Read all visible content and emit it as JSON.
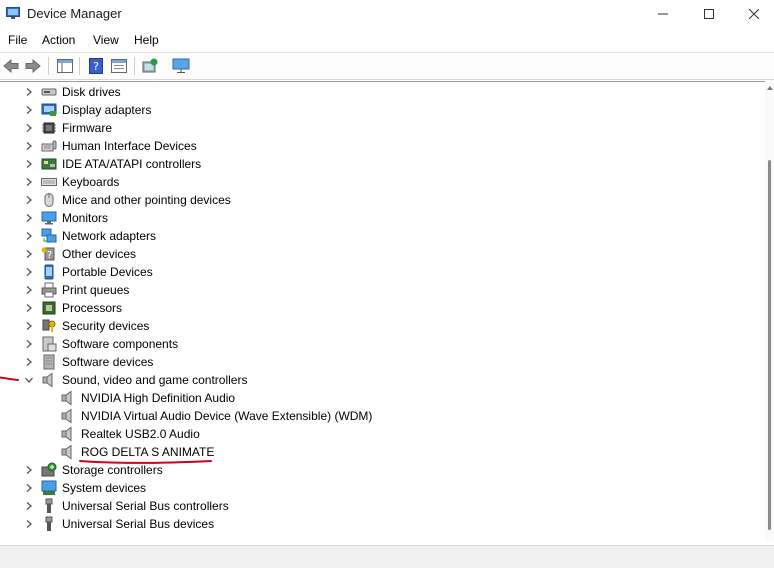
{
  "window": {
    "title": "Device Manager",
    "icon": "device-manager-icon"
  },
  "menu": [
    "File",
    "Action",
    "View",
    "Help"
  ],
  "toolbar": [
    "back-icon",
    "forward-icon",
    "properties-pane-icon",
    "help-icon",
    "show-hidden-icon",
    "scan-hardware-icon",
    "monitor-icon"
  ],
  "tree": {
    "categories": [
      {
        "label": "Disk drives",
        "icon": "disk-icon",
        "expanded": false
      },
      {
        "label": "Display adapters",
        "icon": "display-adapter-icon",
        "expanded": false
      },
      {
        "label": "Firmware",
        "icon": "chip-icon",
        "expanded": false
      },
      {
        "label": "Human Interface Devices",
        "icon": "hid-icon",
        "expanded": false
      },
      {
        "label": "IDE ATA/ATAPI controllers",
        "icon": "ide-controller-icon",
        "expanded": false
      },
      {
        "label": "Keyboards",
        "icon": "keyboard-icon",
        "expanded": false
      },
      {
        "label": "Mice and other pointing devices",
        "icon": "mouse-icon",
        "expanded": false
      },
      {
        "label": "Monitors",
        "icon": "monitor-icon",
        "expanded": false
      },
      {
        "label": "Network adapters",
        "icon": "network-icon",
        "expanded": false
      },
      {
        "label": "Other devices",
        "icon": "unknown-device-icon",
        "expanded": false
      },
      {
        "label": "Portable Devices",
        "icon": "portable-device-icon",
        "expanded": false
      },
      {
        "label": "Print queues",
        "icon": "printer-icon",
        "expanded": false
      },
      {
        "label": "Processors",
        "icon": "processor-icon",
        "expanded": false
      },
      {
        "label": "Security devices",
        "icon": "security-key-icon",
        "expanded": false
      },
      {
        "label": "Software components",
        "icon": "software-component-icon",
        "expanded": false
      },
      {
        "label": "Software devices",
        "icon": "software-device-icon",
        "expanded": false
      },
      {
        "label": "Sound, video and game controllers",
        "icon": "speaker-icon",
        "expanded": true,
        "children": [
          {
            "label": "NVIDIA High Definition Audio",
            "icon": "speaker-icon"
          },
          {
            "label": "NVIDIA Virtual Audio Device (Wave Extensible) (WDM)",
            "icon": "speaker-icon"
          },
          {
            "label": "Realtek USB2.0 Audio",
            "icon": "speaker-icon"
          },
          {
            "label": "ROG DELTA S ANIMATE",
            "icon": "speaker-icon"
          }
        ]
      },
      {
        "label": "Storage controllers",
        "icon": "storage-controller-icon",
        "expanded": false
      },
      {
        "label": "System devices",
        "icon": "system-device-icon",
        "expanded": false
      },
      {
        "label": "Universal Serial Bus controllers",
        "icon": "usb-icon",
        "expanded": false
      },
      {
        "label": "Universal Serial Bus devices",
        "icon": "usb-icon",
        "expanded": false
      }
    ]
  },
  "annotation_color": "#d0021b"
}
